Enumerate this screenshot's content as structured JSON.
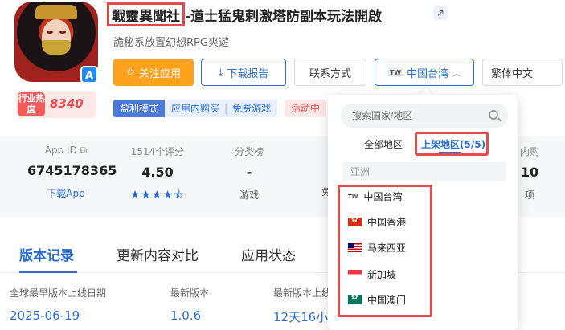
{
  "app": {
    "title_highlight": "戰靈異聞社",
    "title_rest": "-道士猛鬼刺激塔防副本玩法開啟",
    "subtitle": "詭秘系放置幻想RPG爽遊",
    "store_icon": "app-store-icon",
    "external_icon": "external-link-icon"
  },
  "heat": {
    "label": "行业热度",
    "value": "8340"
  },
  "actions": {
    "follow": "关注应用",
    "report": "下载报告",
    "contact": "联系方式",
    "region_code": "TW",
    "region": "中国台湾",
    "language": "繁体中文"
  },
  "tags": {
    "profit_model": "盈利模式",
    "in_app": "应用内购买",
    "free": "免费游戏",
    "event": "活动中"
  },
  "stats": {
    "app_id_label": "App ID",
    "app_id": "6745178365",
    "download_link": "下载App",
    "ratings_label": "1514个评分",
    "rating": "4.50",
    "rating_stars": "★★★★⯪",
    "category_label": "分类榜",
    "category_value": "-",
    "category_type": "游戏",
    "hidden_label_tail": "内购",
    "hidden_value_tail": "10",
    "hidden_sub_tail": "项",
    "hidden_left_sub": "免"
  },
  "tabs": [
    {
      "label": "版本记录",
      "active": true
    },
    {
      "label": "更新内容对比",
      "active": false
    },
    {
      "label": "应用状态",
      "active": false
    }
  ],
  "version": {
    "first_release_label": "全球最早版本上线日期",
    "first_release": "2025-06-19",
    "latest_label": "最新版本",
    "latest": "1.0.6",
    "latest_online_label": "最新版本上线",
    "latest_online": "12天16小"
  },
  "region_dropdown": {
    "search_placeholder": "搜索国家/地区",
    "tab_all": "全部地区",
    "tab_listed": "上架地区(5/5)",
    "group": "亚洲",
    "regions": [
      {
        "code": "TW",
        "name": "中国台湾"
      },
      {
        "code": "HK",
        "name": "中国香港"
      },
      {
        "code": "MY",
        "name": "马来西亚"
      },
      {
        "code": "SG",
        "name": "新加坡"
      },
      {
        "code": "MO",
        "name": "中国澳门"
      }
    ]
  },
  "colors": {
    "accent": "#2b6fd6",
    "follow": "#ffa11d",
    "highlight_box": "#e54b4b"
  }
}
